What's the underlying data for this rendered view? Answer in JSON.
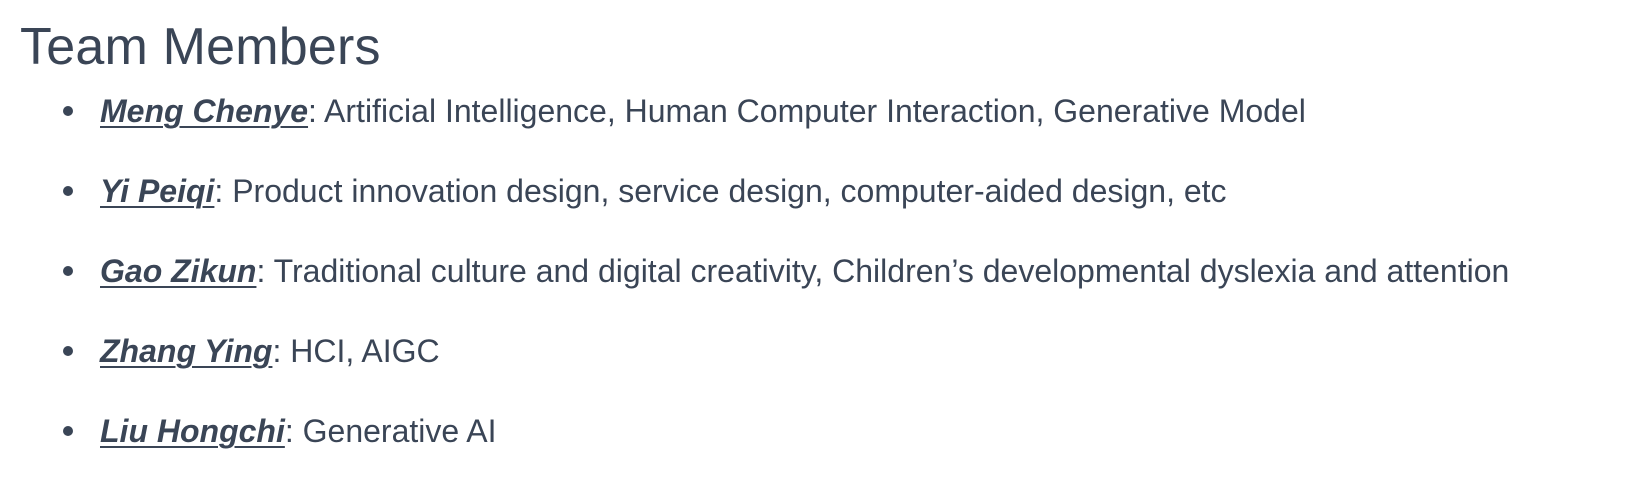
{
  "section": {
    "title": "Team Members"
  },
  "members": [
    {
      "name": "Meng Chenye",
      "separator": ": ",
      "interests": "Artificial Intelligence, Human Computer Interaction, Generative Model"
    },
    {
      "name": "Yi Peiqi",
      "separator": ": ",
      "interests": "Product innovation design, service design, computer-aided design, etc"
    },
    {
      "name": "Gao Zikun",
      "separator": ": ",
      "interests": "Traditional culture and digital creativity, Children’s developmental dyslexia and attention"
    },
    {
      "name": "Zhang Ying",
      "separator": ": ",
      "interests": "HCI, AIGC"
    },
    {
      "name": "Liu Hongchi",
      "separator": ": ",
      "interests": "Generative AI"
    }
  ],
  "colors": {
    "text": "#3a4556",
    "background": "#ffffff"
  }
}
